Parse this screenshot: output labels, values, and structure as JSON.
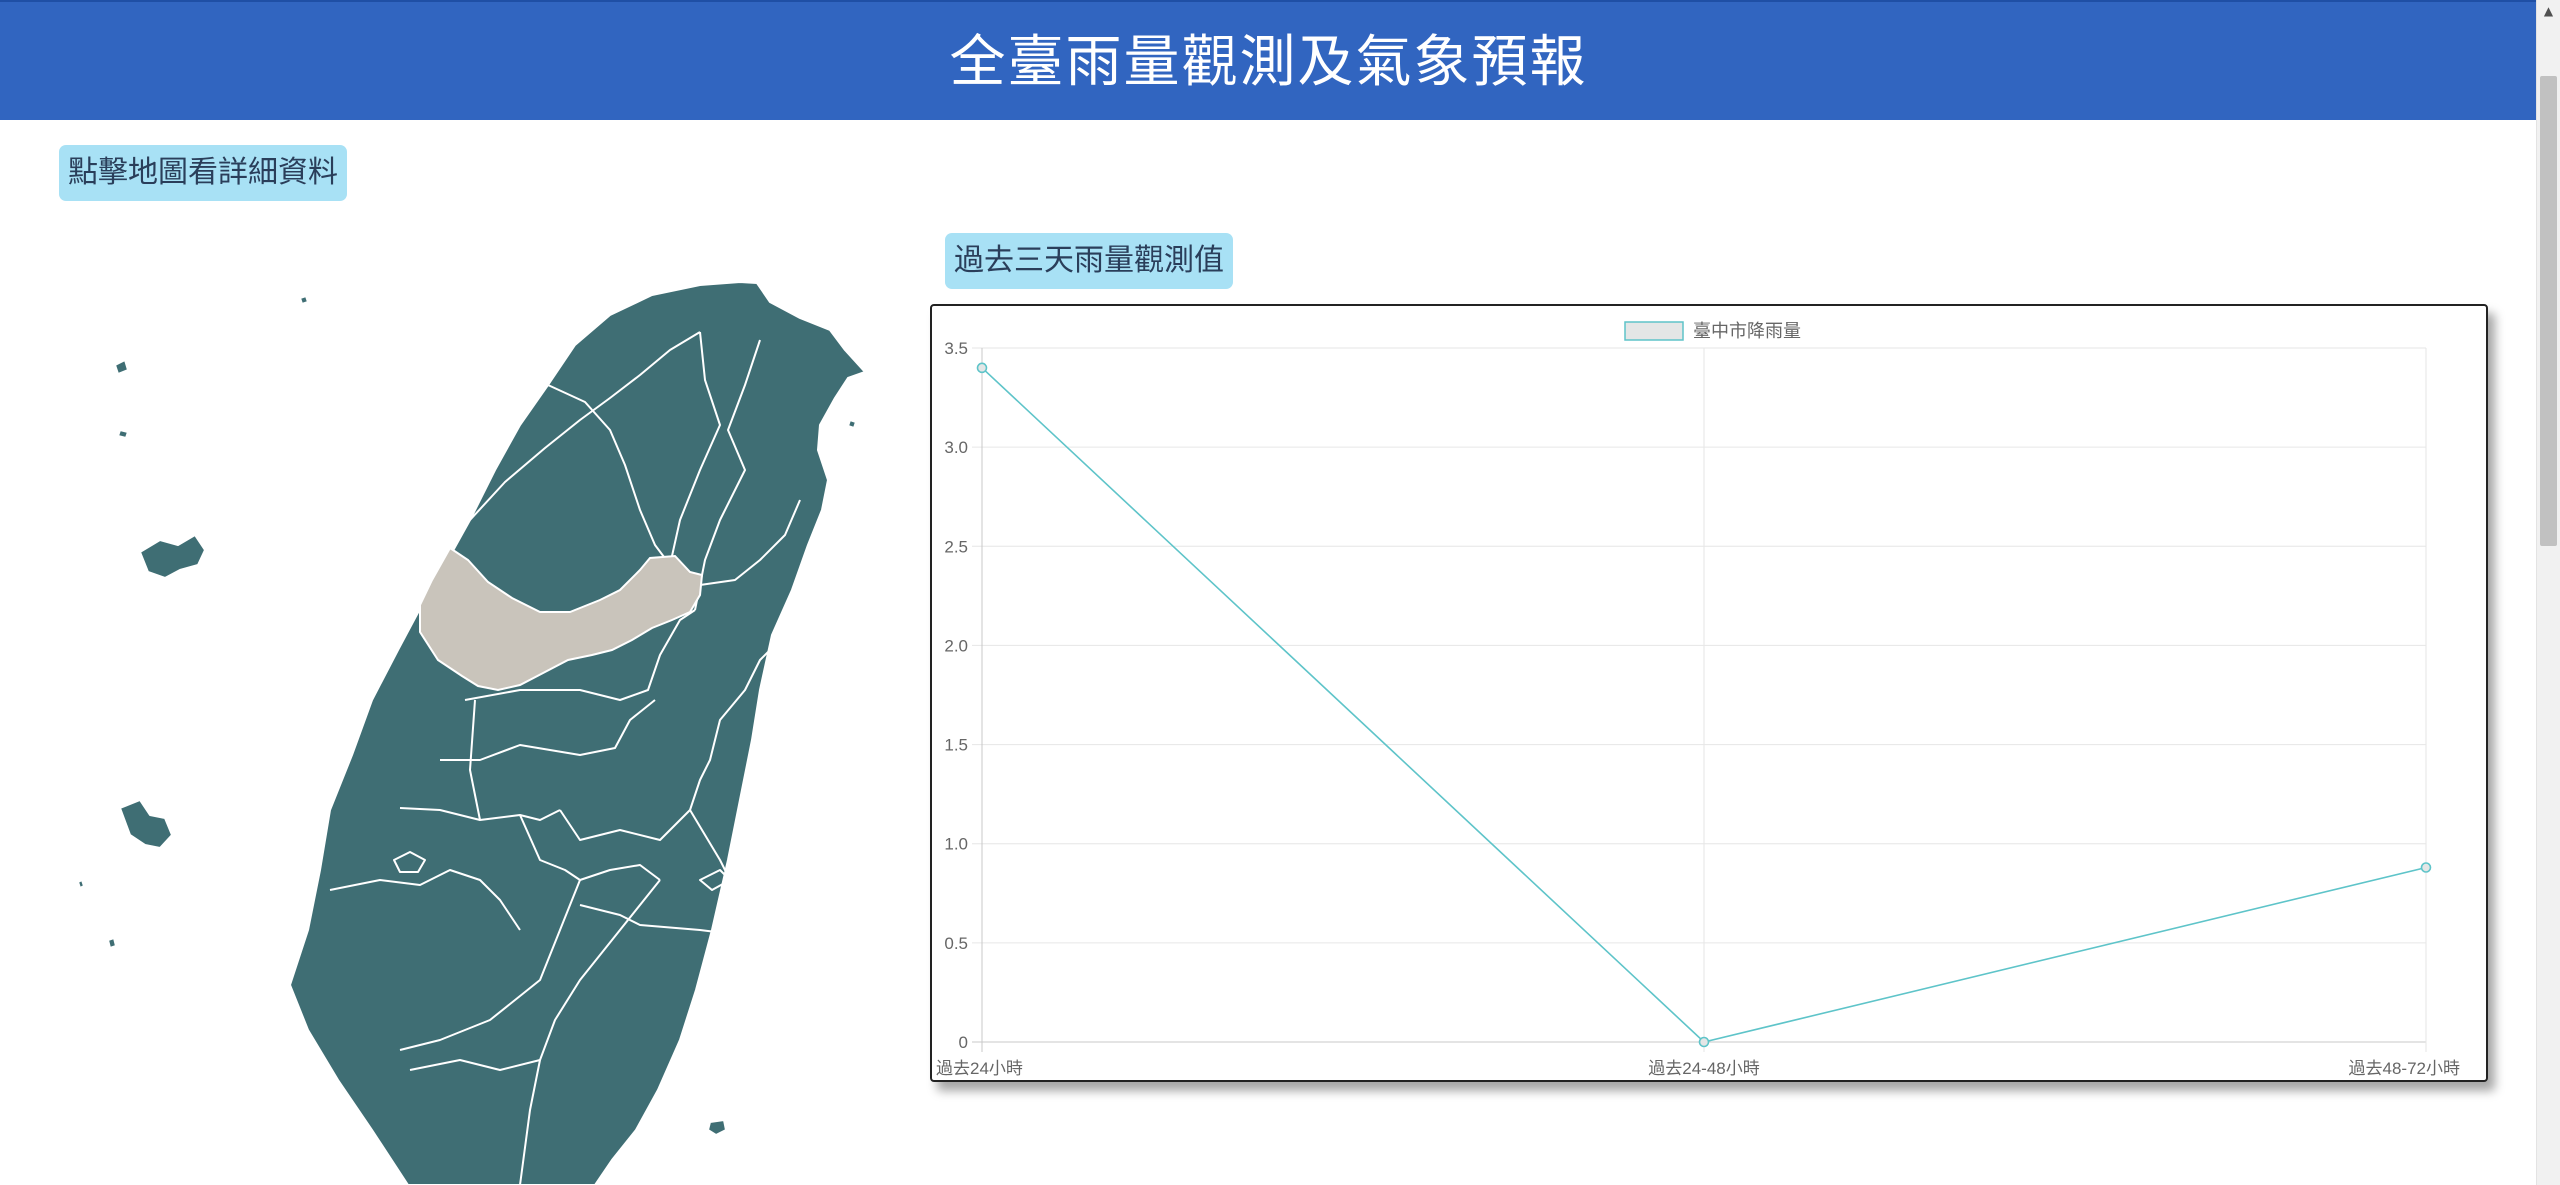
{
  "header": {
    "title": "全臺雨量觀測及氣象預報"
  },
  "map_section": {
    "hint": "點擊地圖看詳細資料",
    "selected_region": "臺中市",
    "colors": {
      "region": "#3f6e74",
      "selected": "#c9c4bb",
      "border": "#ffffff"
    }
  },
  "chart_section": {
    "title": "過去三天雨量觀測值",
    "legend_label": "臺中市降雨量"
  },
  "chart_data": {
    "type": "line",
    "categories": [
      "過去24小時",
      "過去24-48小時",
      "過去48-72小時"
    ],
    "series": [
      {
        "name": "臺中市降雨量",
        "values": [
          3.4,
          0.0,
          0.88
        ],
        "color": "#5ec4c9"
      }
    ],
    "ylim": [
      0,
      3.5
    ],
    "yticks": [
      "0",
      "0.5",
      "1.0",
      "1.5",
      "2.0",
      "2.5",
      "3.0",
      "3.5"
    ],
    "grid": true,
    "legend": "top-center"
  },
  "icons": {
    "scroll_up": "▲"
  }
}
